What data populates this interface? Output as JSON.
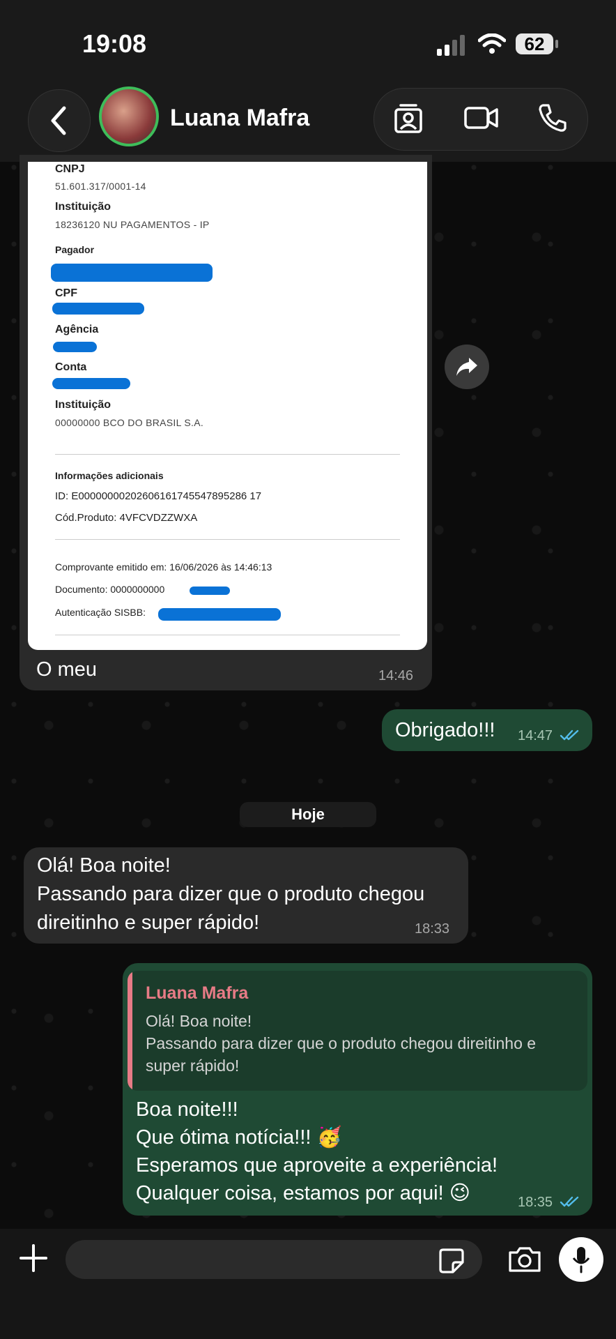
{
  "status_bar": {
    "time": "19:08",
    "battery": "62"
  },
  "header": {
    "contact_name": "Luana Mafra"
  },
  "receipt": {
    "cnpj_label": "CNPJ",
    "cnpj_value": "51.601.317/0001-14",
    "institution1_label": "Instituição",
    "institution1_value": "18236120 NU PAGAMENTOS - IP",
    "payer_label": "Pagador",
    "cpf_label": "CPF",
    "agency_label": "Agência",
    "account_label": "Conta",
    "institution2_label": "Instituição",
    "institution2_value": "00000000 BCO DO BRASIL S.A.",
    "additional_label": "Informações adicionais",
    "id_line": "ID: E00000000202606161745547895286 17",
    "product_line": "Cód.Produto: 4VFCVDZZWXA",
    "issued_line": "Comprovante emitido em: 16/06/2026 às 14:46:13",
    "document_label": "Documento: 0000000000",
    "auth_label": "Autenticação SISBB:"
  },
  "messages": [
    {
      "dir": "in",
      "text": "O meu",
      "time": "14:46"
    },
    {
      "dir": "out",
      "text": "Obrigado!!!",
      "time": "14:47"
    },
    {
      "dir": "in",
      "lines": [
        "Olá! Boa noite!",
        "Passando para dizer que o produto chegou",
        "direitinho e super rápido!"
      ],
      "time": "18:33"
    },
    {
      "dir": "out",
      "quote": {
        "name": "Luana Mafra",
        "text": "Olá! Boa noite!\nPassando para dizer que o produto chegou direitinho e super rápido!"
      },
      "lines": [
        "Boa noite!!!",
        "Que ótima notícia!!! 🥳",
        "Esperamos que aproveite a experiência!",
        "Qualquer coisa, estamos por aqui! 😉"
      ],
      "time": "18:35"
    }
  ],
  "date_separator": "Hoje",
  "composer": {
    "placeholder": ""
  },
  "colors": {
    "incoming": "#2a2a2a",
    "outgoing": "#1f4a34",
    "read_ticks": "#53bdeb",
    "quote_name": "#e77b86"
  }
}
